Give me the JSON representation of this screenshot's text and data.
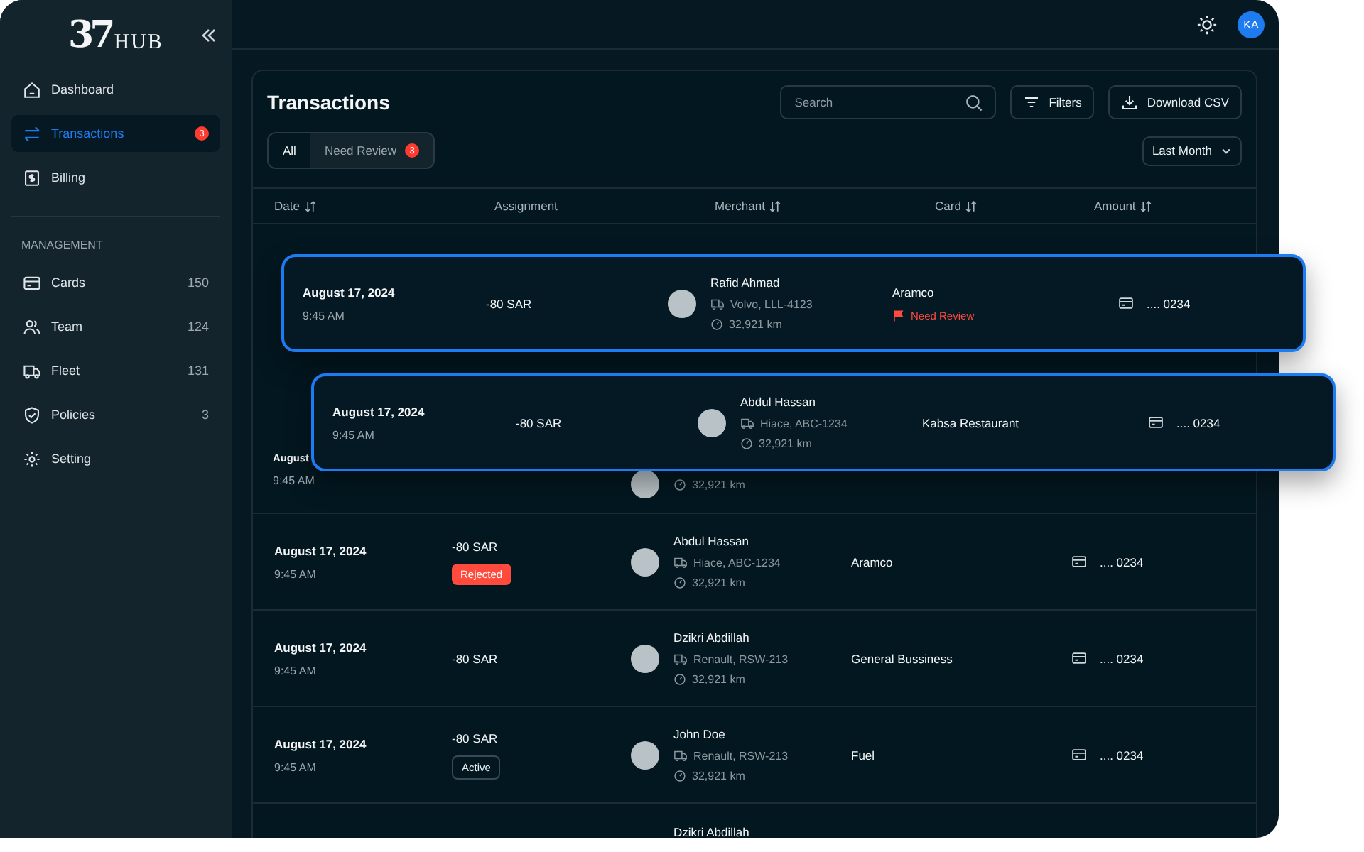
{
  "logo": {
    "numeral": "37",
    "word": "HUB"
  },
  "sidebar": {
    "main": [
      {
        "label": "Dashboard",
        "selected": false
      },
      {
        "label": "Transactions",
        "selected": true,
        "badge": "3"
      },
      {
        "label": "Billing",
        "selected": false
      }
    ],
    "section_title": "MANAGEMENT",
    "management": [
      {
        "label": "Cards",
        "count": "150",
        "selected": false
      },
      {
        "label": "Team",
        "count": "124",
        "selected": false
      },
      {
        "label": "Fleet",
        "count": "131",
        "selected": false
      },
      {
        "label": "Policies",
        "count": "3",
        "selected": false
      },
      {
        "label": "Setting",
        "selected": false
      }
    ]
  },
  "topbar": {
    "avatar_initials": "KA"
  },
  "panel": {
    "title": "Transactions",
    "search": {
      "placeholder": "Search"
    },
    "buttons": [
      {
        "label": "Filters"
      },
      {
        "label": "Download CSV"
      }
    ],
    "tabs": [
      {
        "label": "All",
        "selected": true
      },
      {
        "label": "Need Review",
        "selected": false,
        "badge": "3"
      }
    ],
    "period": "Last Month"
  },
  "table": {
    "columns": [
      {
        "label": "Date",
        "sortable": true
      },
      {
        "label": "Assignment",
        "sortable": false
      },
      {
        "label": "Merchant",
        "sortable": true
      },
      {
        "label": "Card",
        "sortable": true
      },
      {
        "label": "Amount",
        "sortable": true
      }
    ],
    "partial_row": {
      "date": "August",
      "time": "9:45 AM",
      "distance": "32,921 km"
    },
    "rows": [
      {
        "date": "August 17, 2024",
        "time": "9:45 AM",
        "amount": "-80 SAR",
        "status": {
          "kind": "rejected",
          "label": "Rejected"
        },
        "name": "Abdul Hassan",
        "vehicle": "Hiace, ABC-1234",
        "distance": "32,921 km",
        "merchant": "Aramco",
        "card": ".... 0234"
      },
      {
        "date": "August 17, 2024",
        "time": "9:45 AM",
        "amount": "-80 SAR",
        "name": "Dzikri Abdillah",
        "vehicle": "Renault, RSW-213",
        "distance": "32,921 km",
        "merchant": "General Bussiness",
        "card": ".... 0234"
      },
      {
        "date": "August 17, 2024",
        "time": "9:45 AM",
        "amount": "-80 SAR",
        "status": {
          "kind": "active",
          "label": "Active"
        },
        "name": "John Doe",
        "vehicle": "Renault, RSW-213",
        "distance": "32,921 km",
        "merchant": "Fuel",
        "card": ".... 0234"
      }
    ],
    "last_row_name": "Dzikri Abdillah"
  },
  "floating_rows": [
    {
      "date": "August 17, 2024",
      "time": "9:45 AM",
      "amount": "-80 SAR",
      "name": "Rafid Ahmad",
      "vehicle": "Volvo, LLL-4123",
      "distance": "32,921 km",
      "merchant": "Aramco",
      "flag": "Need Review",
      "card": ".... 0234"
    },
    {
      "date": "August 17, 2024",
      "time": "9:45 AM",
      "amount": "-80 SAR",
      "name": "Abdul Hassan",
      "vehicle": "Hiace, ABC-1234",
      "distance": "32,921 km",
      "merchant": "Kabsa Restaurant",
      "card": ".... 0234"
    }
  ]
}
